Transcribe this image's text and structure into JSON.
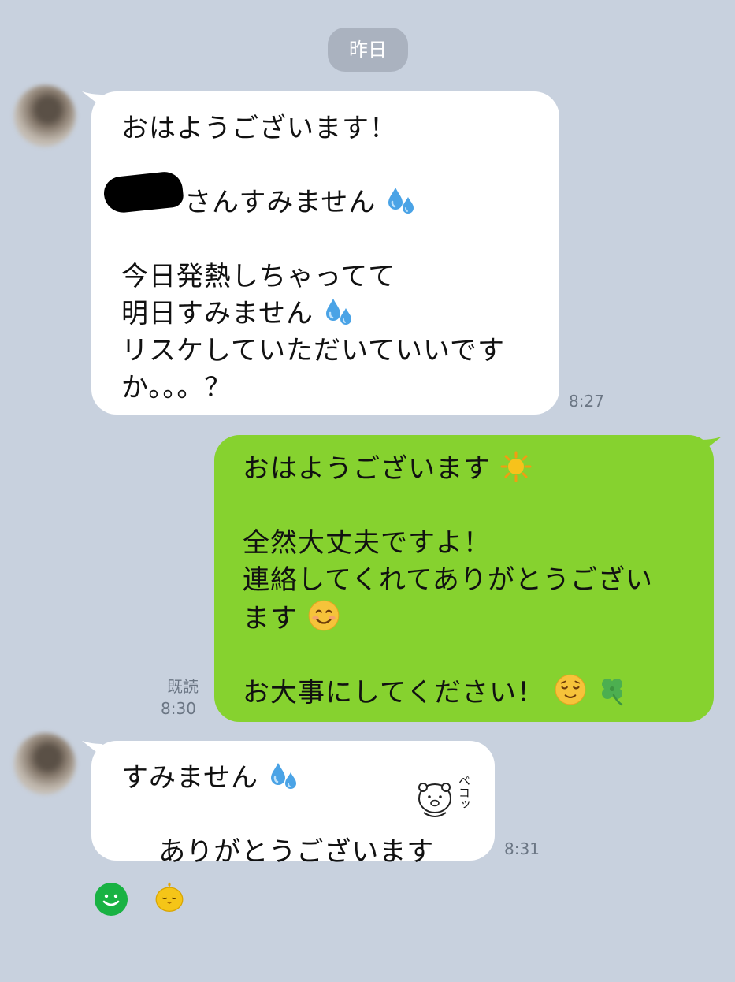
{
  "date_separator": "昨日",
  "messages": [
    {
      "direction": "incoming",
      "lines": [
        "おはようございます！",
        "",
        "さんすみません",
        "",
        "今日発熱しちゃってて",
        "明日すみません",
        "リスケしていただいていいです",
        "か。。。？"
      ],
      "time": "8:27"
    },
    {
      "direction": "outgoing",
      "lines": [
        "おはようございます",
        "",
        "全然大丈夫ですよ！",
        "連絡してくれてありがとうござい",
        "ます",
        "",
        "お大事にしてください！"
      ],
      "read_label": "既読",
      "time": "8:30"
    },
    {
      "direction": "incoming",
      "lines": [
        "すみません",
        "ありがとうございます"
      ],
      "sticker_text": "ペコッ",
      "time": "8:31"
    }
  ],
  "icons": {
    "sweat": "sweat-droplets-icon",
    "sun": "sun-icon",
    "smile": "smiling-face-icon",
    "relieved": "relieved-face-icon",
    "clover": "four-leaf-clover-icon"
  },
  "colors": {
    "background": "#c8d1de",
    "incoming_bubble": "#ffffff",
    "outgoing_bubble": "#86d22f",
    "timestamp": "#6b7684",
    "date_pill": "#aab2bf"
  }
}
